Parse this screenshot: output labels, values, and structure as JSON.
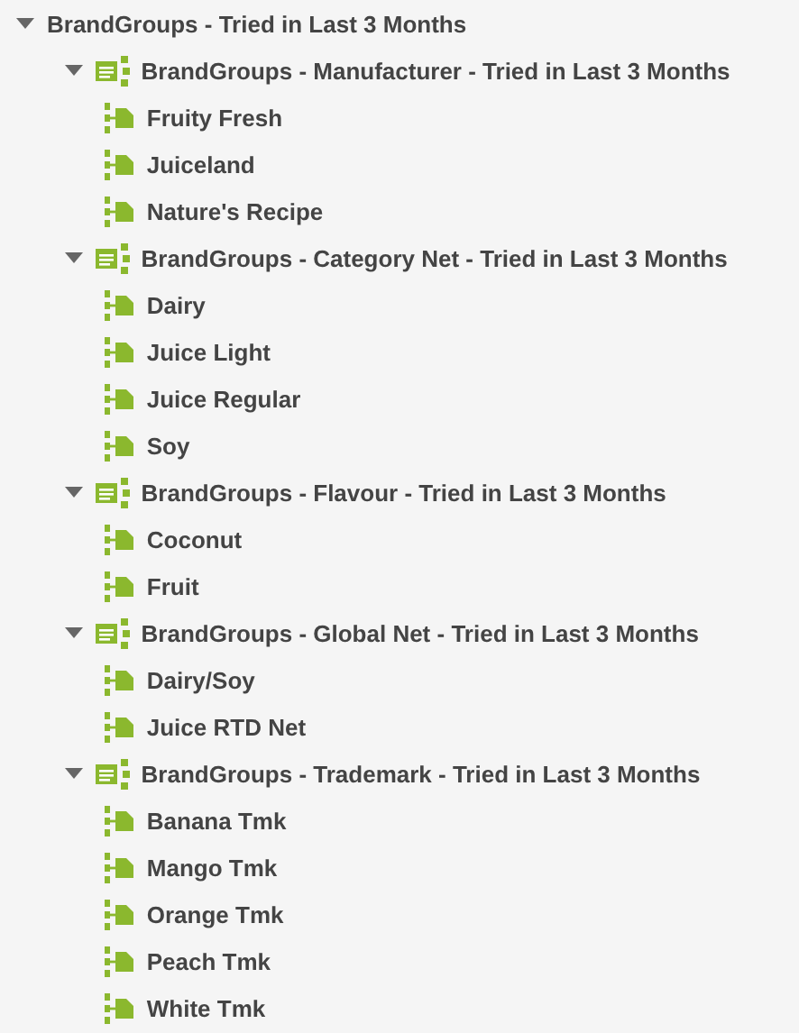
{
  "tree": [
    {
      "label": "BrandGroups - Tried in Last 3 Months",
      "kind": "root",
      "expanded": true,
      "children": [
        {
          "label": "BrandGroups - Manufacturer - Tried in Last 3 Months",
          "kind": "group",
          "expanded": true,
          "children": [
            {
              "label": "Fruity Fresh",
              "kind": "item"
            },
            {
              "label": "Juiceland",
              "kind": "item"
            },
            {
              "label": "Nature's Recipe",
              "kind": "item"
            }
          ]
        },
        {
          "label": "BrandGroups - Category Net - Tried in Last 3 Months",
          "kind": "group",
          "expanded": true,
          "children": [
            {
              "label": "Dairy",
              "kind": "item"
            },
            {
              "label": "Juice Light",
              "kind": "item"
            },
            {
              "label": "Juice Regular",
              "kind": "item"
            },
            {
              "label": "Soy",
              "kind": "item"
            }
          ]
        },
        {
          "label": "BrandGroups - Flavour - Tried in Last 3 Months",
          "kind": "group",
          "expanded": true,
          "children": [
            {
              "label": "Coconut",
              "kind": "item"
            },
            {
              "label": "Fruit",
              "kind": "item"
            }
          ]
        },
        {
          "label": "BrandGroups - Global Net - Tried in Last 3 Months",
          "kind": "group",
          "expanded": true,
          "children": [
            {
              "label": "Dairy/Soy",
              "kind": "item"
            },
            {
              "label": "Juice RTD Net",
              "kind": "item"
            }
          ]
        },
        {
          "label": "BrandGroups - Trademark - Tried in Last 3 Months",
          "kind": "group",
          "expanded": true,
          "children": [
            {
              "label": "Banana Tmk",
              "kind": "item"
            },
            {
              "label": "Mango Tmk",
              "kind": "item"
            },
            {
              "label": "Orange Tmk",
              "kind": "item"
            },
            {
              "label": "Peach Tmk",
              "kind": "item"
            },
            {
              "label": "White Tmk",
              "kind": "item"
            }
          ]
        }
      ]
    }
  ]
}
